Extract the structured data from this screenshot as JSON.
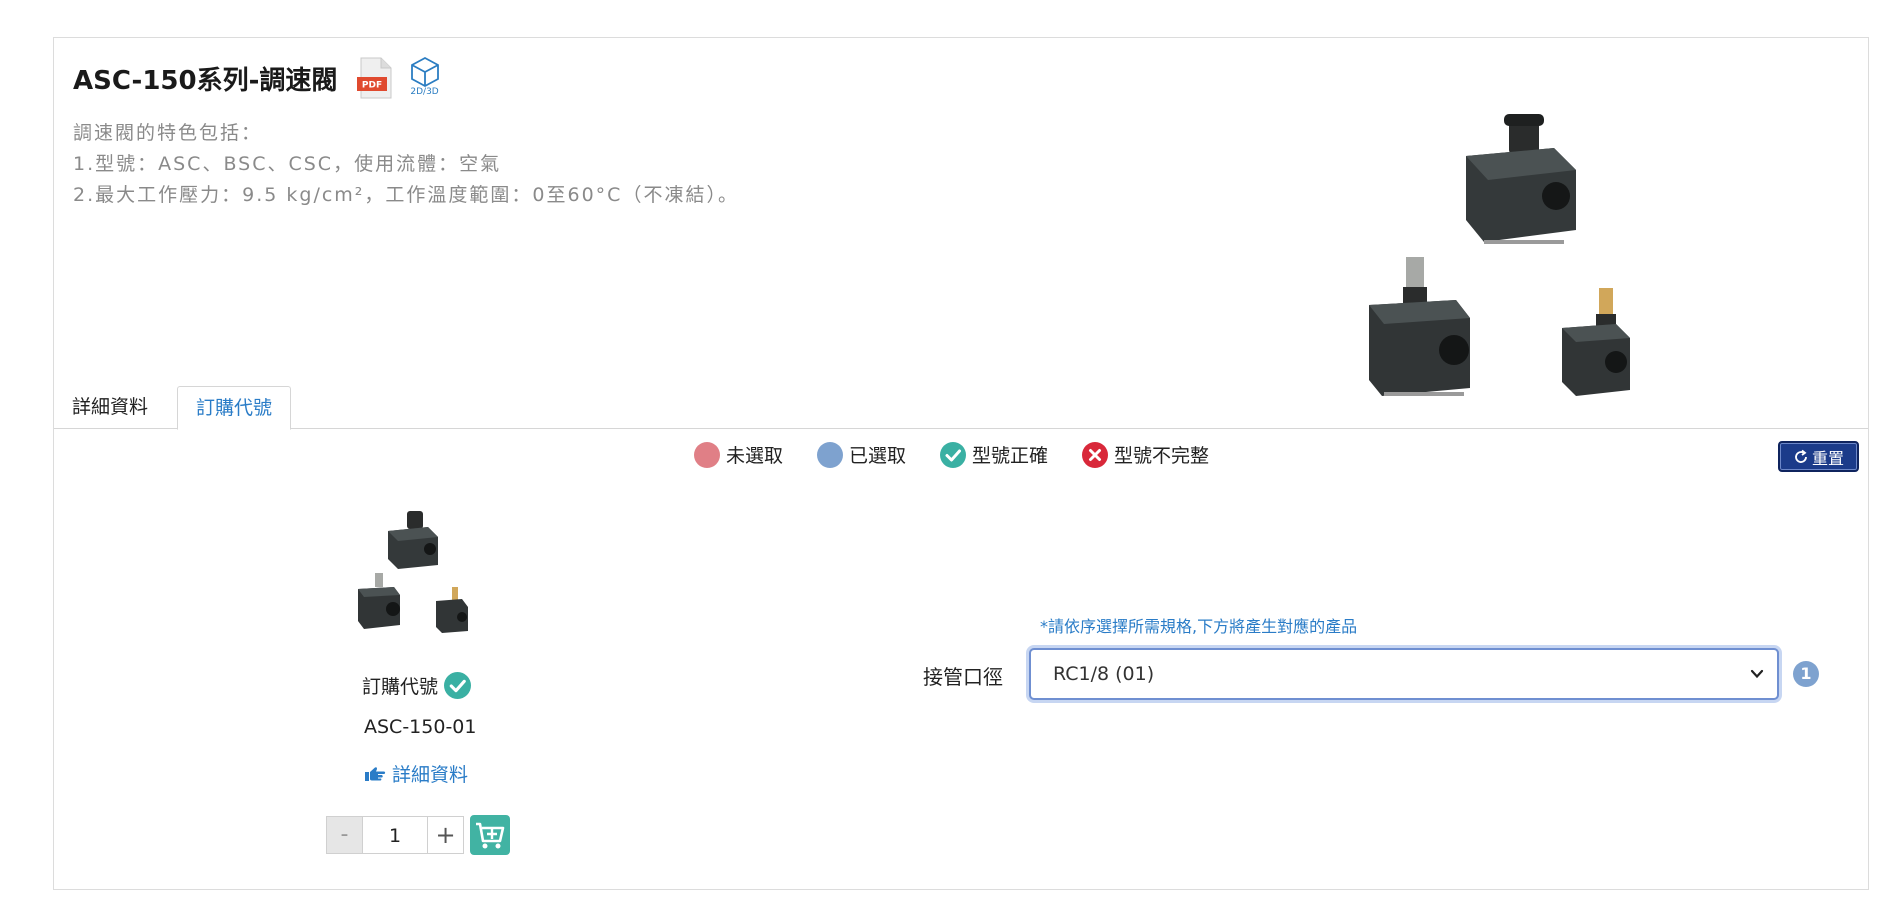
{
  "product": {
    "title": "ASC-150系列-調速閥",
    "pdf_icon": "pdf-file-icon",
    "cad_icon": "cube-3d-icon",
    "cad_label": "2D/3D",
    "description_lines": [
      "調速閥的特色包括：",
      "1.型號：ASC、BSC、CSC，使用流體：空氣",
      "2.最大工作壓力：9.5 kg/cm²，工作溫度範圍：0至60°C（不凍結）。"
    ]
  },
  "tabs": [
    {
      "label": "詳細資料",
      "active": false
    },
    {
      "label": "訂購代號",
      "active": true
    }
  ],
  "legend": [
    {
      "label": "未選取",
      "color": "#e07f86",
      "icon": "red-dot"
    },
    {
      "label": "已選取",
      "color": "#7ea2cf",
      "icon": "blue-dot"
    },
    {
      "label": "型號正確",
      "color": "#3ab0a3",
      "icon": "check-circle-icon"
    },
    {
      "label": "型號不完整",
      "color": "#d9283a",
      "icon": "x-circle-icon"
    }
  ],
  "reset_button": {
    "label": "重置",
    "icon": "refresh-icon"
  },
  "order": {
    "label": "訂購代號",
    "code": "ASC-150-01",
    "details_link": "詳細資料",
    "quantity": "1",
    "minus_label": "-",
    "plus_label": "+"
  },
  "selector": {
    "hint": "*請依序選擇所需規格,下方將產生對應的產品",
    "label": "接管口徑",
    "value": "RC1/8 (01)",
    "step": "1"
  },
  "colors": {
    "accent_blue": "#2a7cc7",
    "reset_bg": "#1b3b8a",
    "cart_green": "#41b3a3"
  }
}
